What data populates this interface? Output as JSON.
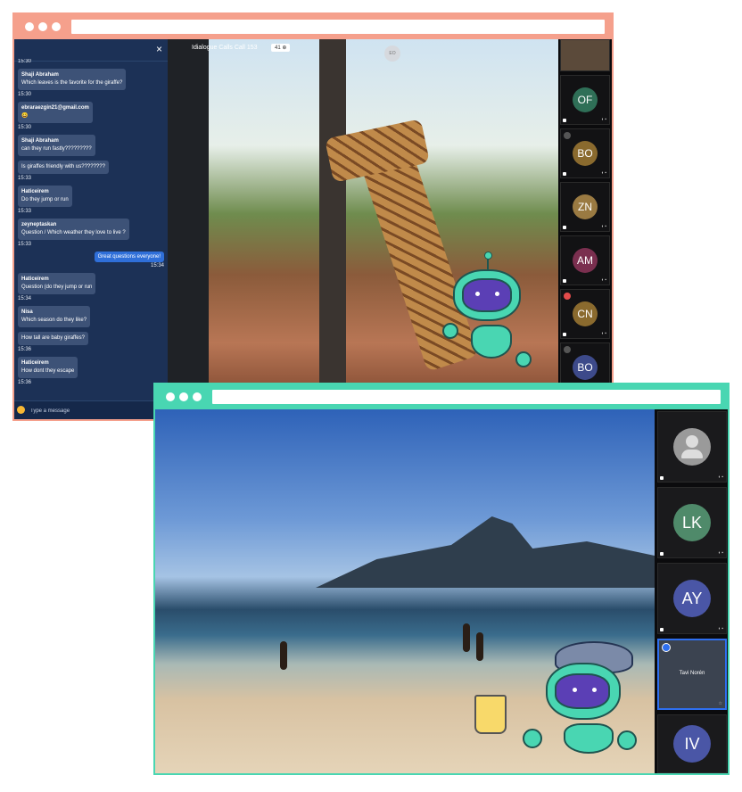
{
  "window1": {
    "call_title": "Idialogue Calls Call 153",
    "participant_count": "41 ⊕",
    "corner_avatar": "EO",
    "chat_close": "×",
    "input_placeholder": "Type a message",
    "messages": [
      {
        "sender": "",
        "text": "",
        "time": "15:30"
      },
      {
        "sender": "Shaji Abraham",
        "text": "Which leaves is the favorite for the giraffe?",
        "time": "15:30"
      },
      {
        "sender": "ebraraezgin21@gmail.com",
        "text": "😀",
        "time": "15:30"
      },
      {
        "sender": "Shaji Abraham",
        "text": "can they run fastly?????????",
        "time": ""
      },
      {
        "sender": "",
        "text": "Is giraffes friendly with us????????",
        "time": "15:33"
      },
      {
        "sender": "Haticeirem",
        "text": "Do they jump or run",
        "time": "15:33"
      },
      {
        "sender": "zeyneptaskan",
        "text": "Question / Which weather they love to live ?",
        "time": "15:33"
      }
    ],
    "mine": {
      "text": "Great questions everyone!",
      "time": "15:34"
    },
    "messages_after": [
      {
        "sender": "Haticeirem",
        "text": "Question (do they jump or run",
        "time": "15:34"
      },
      {
        "sender": "Nisa",
        "text": "Which season do they like?",
        "time": ""
      },
      {
        "sender": "",
        "text": "How tall are baby giraffes?",
        "time": "15:36"
      },
      {
        "sender": "Haticeirem",
        "text": "How dont they escape",
        "time": "15:36"
      }
    ],
    "tiles": [
      {
        "initials": "",
        "color": "#5b4a3a"
      },
      {
        "initials": "OF",
        "color": "#2f6f57"
      },
      {
        "initials": "BO",
        "color": "#8a6a2e"
      },
      {
        "initials": "ZN",
        "color": "#9a7a42"
      },
      {
        "initials": "AM",
        "color": "#7a2f4f"
      },
      {
        "initials": "CN",
        "color": "#8a6a2e"
      },
      {
        "initials": "BO",
        "color": "#3d4a8a"
      }
    ]
  },
  "window2": {
    "tiles": [
      {
        "initials": "",
        "name": "",
        "color": "#9a9a9a"
      },
      {
        "initials": "LK",
        "name": "",
        "color": "#4f8a6a"
      },
      {
        "initials": "AY",
        "name": "",
        "color": "#4a56a6"
      },
      {
        "initials": "",
        "name": "Tavi Norén",
        "color": "#3b4350"
      },
      {
        "initials": "IV",
        "name": "",
        "color": "#4a56a6"
      }
    ]
  },
  "colors": {
    "window1_frame": "#f5a08c",
    "window2_frame": "#49d6b2",
    "chat_bg": "#1c3156",
    "chat_bubble": "#3d5277",
    "my_bubble": "#2f6fd9",
    "robot_green": "#49d6b2",
    "robot_visor": "#5b3fb5"
  }
}
